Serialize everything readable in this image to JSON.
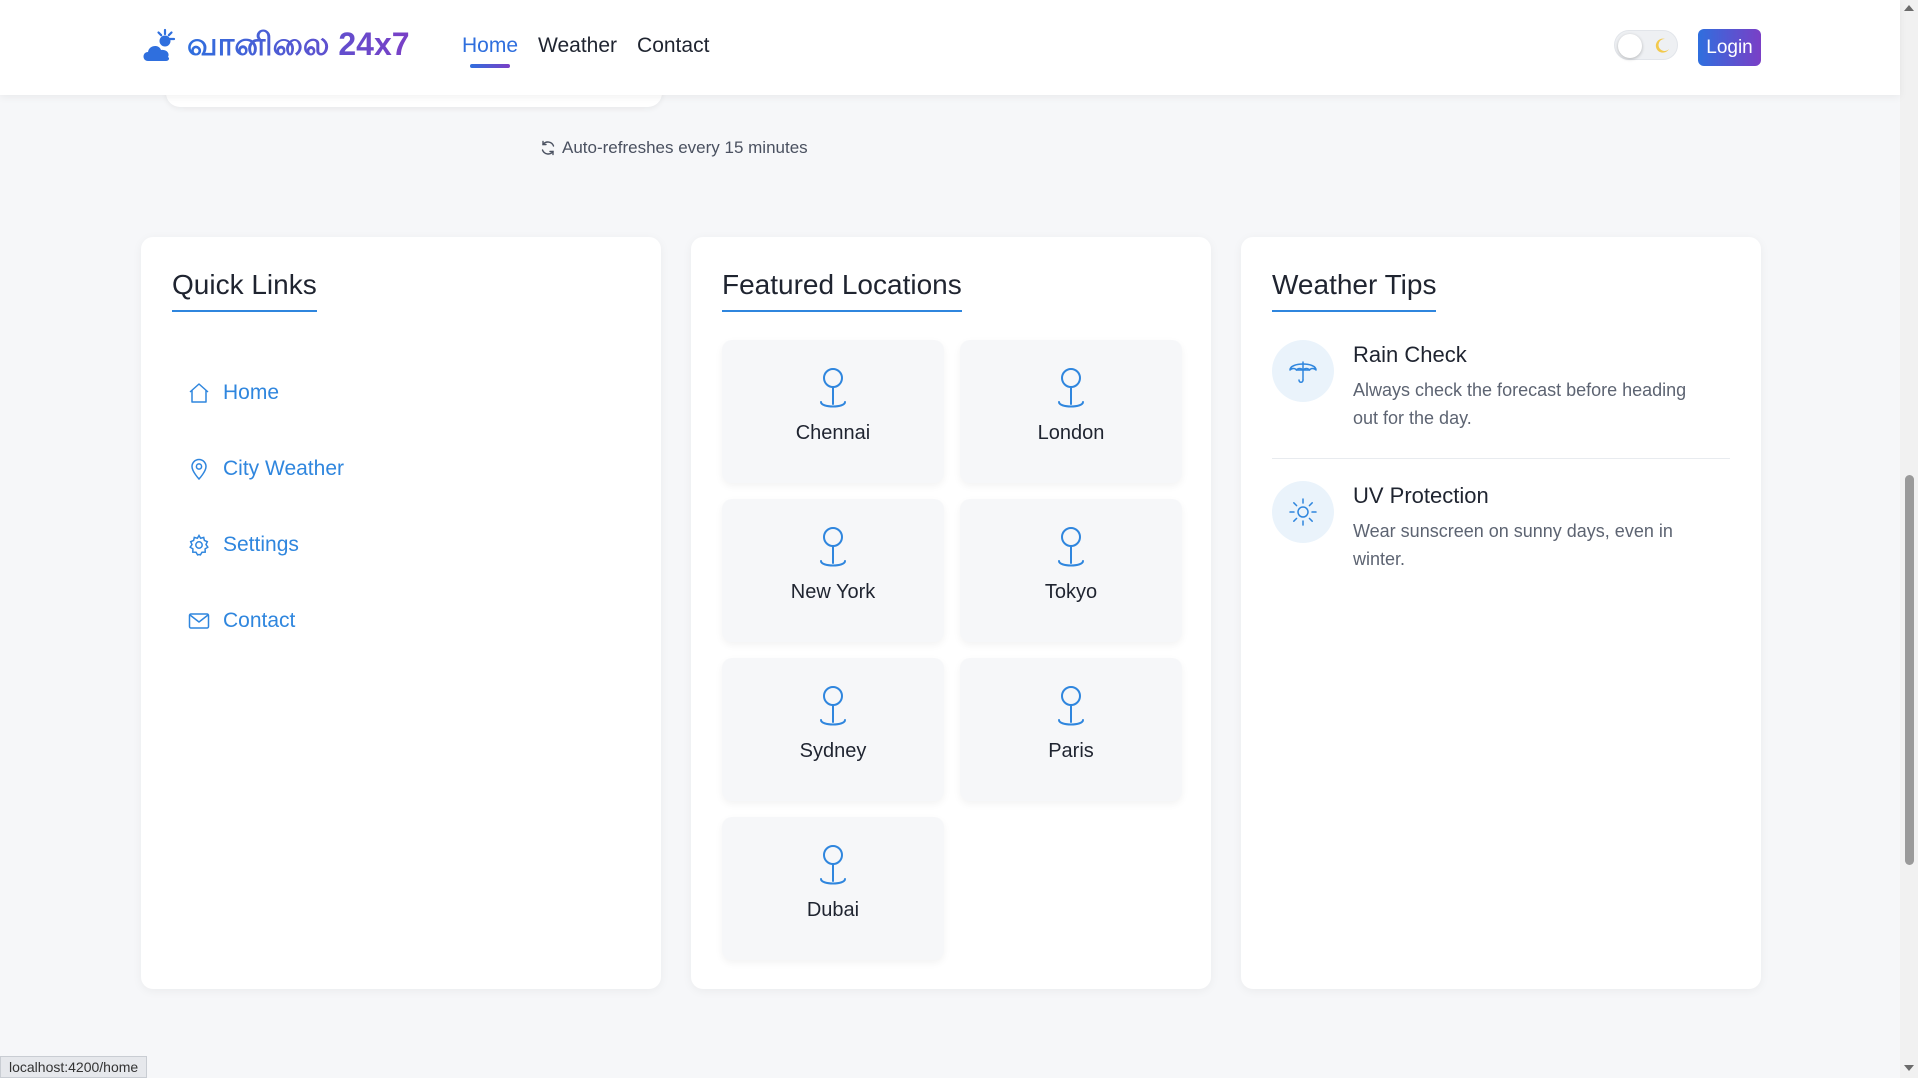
{
  "navbar": {
    "brand": "வானிலை 24x7",
    "links": [
      {
        "label": "Home",
        "active": true
      },
      {
        "label": "Weather",
        "active": false
      },
      {
        "label": "Contact",
        "active": false
      }
    ],
    "theme_toggle": {
      "state": "light"
    },
    "login_label": "Login"
  },
  "auto_refresh": "Auto-refreshes every 15 minutes",
  "quick_links": {
    "title": "Quick Links",
    "items": [
      {
        "label": "Home",
        "icon": "home-icon"
      },
      {
        "label": "City Weather",
        "icon": "location-pin-icon"
      },
      {
        "label": "Settings",
        "icon": "gear-icon"
      },
      {
        "label": "Contact",
        "icon": "envelope-icon"
      }
    ]
  },
  "featured": {
    "title": "Featured Locations",
    "locations": [
      "Chennai",
      "London",
      "New York",
      "Tokyo",
      "Sydney",
      "Paris",
      "Dubai"
    ]
  },
  "tips": {
    "title": "Weather Tips",
    "items": [
      {
        "title": "Rain Check",
        "text": "Always check the forecast before heading out for the day.",
        "icon": "umbrella-icon"
      },
      {
        "title": "UV Protection",
        "text": "Wear sunscreen on sunny days, even in winter.",
        "icon": "sun-icon"
      }
    ]
  },
  "status_bar": "localhost:4200/home",
  "colors": {
    "accent": "#2f86de",
    "brand_start": "#2f6fde",
    "brand_end": "#7a3fc6"
  }
}
